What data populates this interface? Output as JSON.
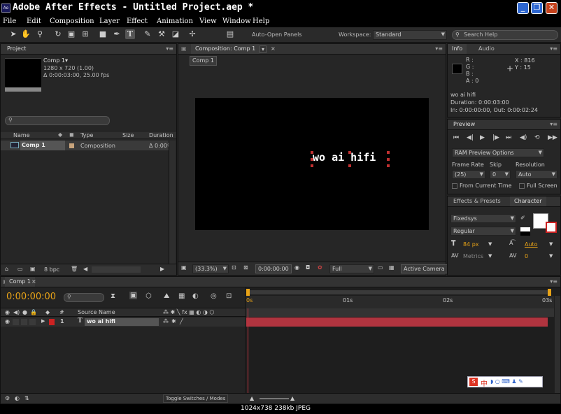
{
  "window": {
    "title": "Adobe After Effects - Untitled Project.aep *",
    "app_badge": "Ae",
    "buttons": [
      "_",
      "❐",
      "✕"
    ]
  },
  "menu": [
    "File",
    "Edit",
    "Composition",
    "Layer",
    "Effect",
    "Animation",
    "View",
    "Window",
    "Help"
  ],
  "toolbar": {
    "auto_open_label": "Auto-Open Panels",
    "workspace_label": "Workspace:",
    "workspace_value": "Standard",
    "search_placeholder": "Search Help"
  },
  "project": {
    "tab": "Project",
    "comp_name": "Comp 1▾",
    "comp_res": "1280 x 720 (1.00)",
    "comp_dur": "Δ 0:00:03:00, 25.00 fps",
    "columns": [
      "Name",
      "Type",
      "Size",
      "Duration"
    ],
    "row": {
      "name": "Comp 1",
      "type": "Composition",
      "duration": "Δ 0:00"
    },
    "bpc": "8 bpc"
  },
  "composition": {
    "tab": "Composition: Comp 1",
    "subtab": "Comp 1",
    "text": "wo ai hifi",
    "zoom": "(33.3%)",
    "time": "0:00:00:00",
    "quality": "Full",
    "camera": "Active Camera"
  },
  "info": {
    "tabs": [
      "Info",
      "Audio"
    ],
    "rgba": [
      "R :",
      "G :",
      "B :",
      "A : 0"
    ],
    "x": "X : 816",
    "y": "Y : 15",
    "layer": "wo ai hifi",
    "duration": "Duration: 0:00:03:00",
    "inout": "In: 0:00:00:00, Out: 0:00:02:24"
  },
  "preview": {
    "tab": "Preview",
    "ram": "RAM Preview Options",
    "frame_rate_label": "Frame Rate",
    "skip_label": "Skip",
    "resolution_label": "Resolution",
    "frame_rate": "(25)",
    "skip": "0",
    "resolution": "Auto",
    "from_current": "From Current Time",
    "full_screen": "Full Screen"
  },
  "effects": {
    "tabs": [
      "Effects & Presets",
      "Character"
    ]
  },
  "character": {
    "font": "Fixedsys",
    "style": "Regular",
    "size": "84 px",
    "leading": "Auto",
    "kerning": "Metrics",
    "tracking": "0"
  },
  "timeline": {
    "tab": "Comp 1",
    "time": "0:00:00:00",
    "columns": {
      "num": "#",
      "source": "Source Name"
    },
    "layer": {
      "num": "1",
      "name": "wo ai hifi"
    },
    "ruler": [
      "0s",
      "01s",
      "02s",
      "03s"
    ],
    "toggle": "Toggle Switches / Modes"
  },
  "ime": {
    "label": "中"
  },
  "footer": "1024x738  238kb  JPEG",
  "colors": {
    "accent": "#e8a317",
    "layer_bar": "#b0343f",
    "label_red": "#c22",
    "background": "#262626"
  }
}
